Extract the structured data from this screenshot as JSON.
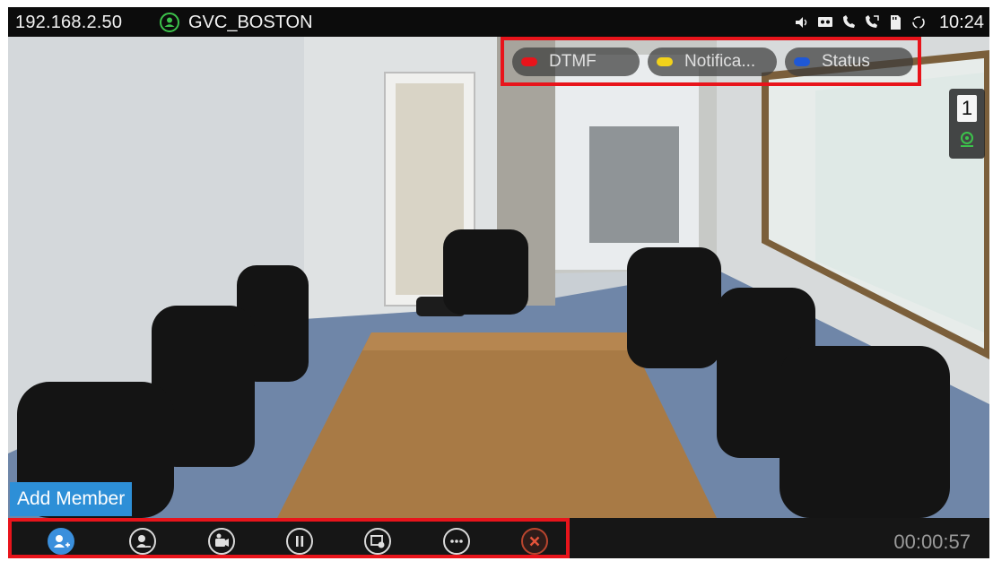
{
  "status_bar": {
    "ip_address": "192.168.2.50",
    "account_name": "GVC_BOSTON",
    "account_icon": "account-online-icon",
    "system_icons": [
      "volume-icon",
      "voicemail-icon",
      "missed-call-icon",
      "forward-call-icon",
      "sd-card-icon",
      "sync-icon"
    ],
    "time": "10:24"
  },
  "softkeys": [
    {
      "label": "DTMF",
      "color": "#e8141b"
    },
    {
      "label": "Notifica...",
      "color": "#f2d21b"
    },
    {
      "label": "Status",
      "color": "#1f58d6"
    }
  ],
  "side_panel": {
    "participant_count": "1",
    "icon": "camera-on-icon"
  },
  "tooltip": {
    "label": "Add Member"
  },
  "toolbar": {
    "buttons": [
      {
        "name": "add-member",
        "icon": "add-member-icon"
      },
      {
        "name": "remove-member",
        "icon": "remove-member-icon"
      },
      {
        "name": "camera",
        "icon": "camera-settings-icon"
      },
      {
        "name": "hold",
        "icon": "pause-icon"
      },
      {
        "name": "presentation",
        "icon": "presentation-icon"
      },
      {
        "name": "more",
        "icon": "more-icon"
      },
      {
        "name": "end-call",
        "icon": "end-call-icon"
      }
    ],
    "call_duration": "00:00:57"
  },
  "colors": {
    "highlight_border": "#e8141b",
    "accent": "#3a8fdc",
    "status_green": "#3cc24b"
  }
}
